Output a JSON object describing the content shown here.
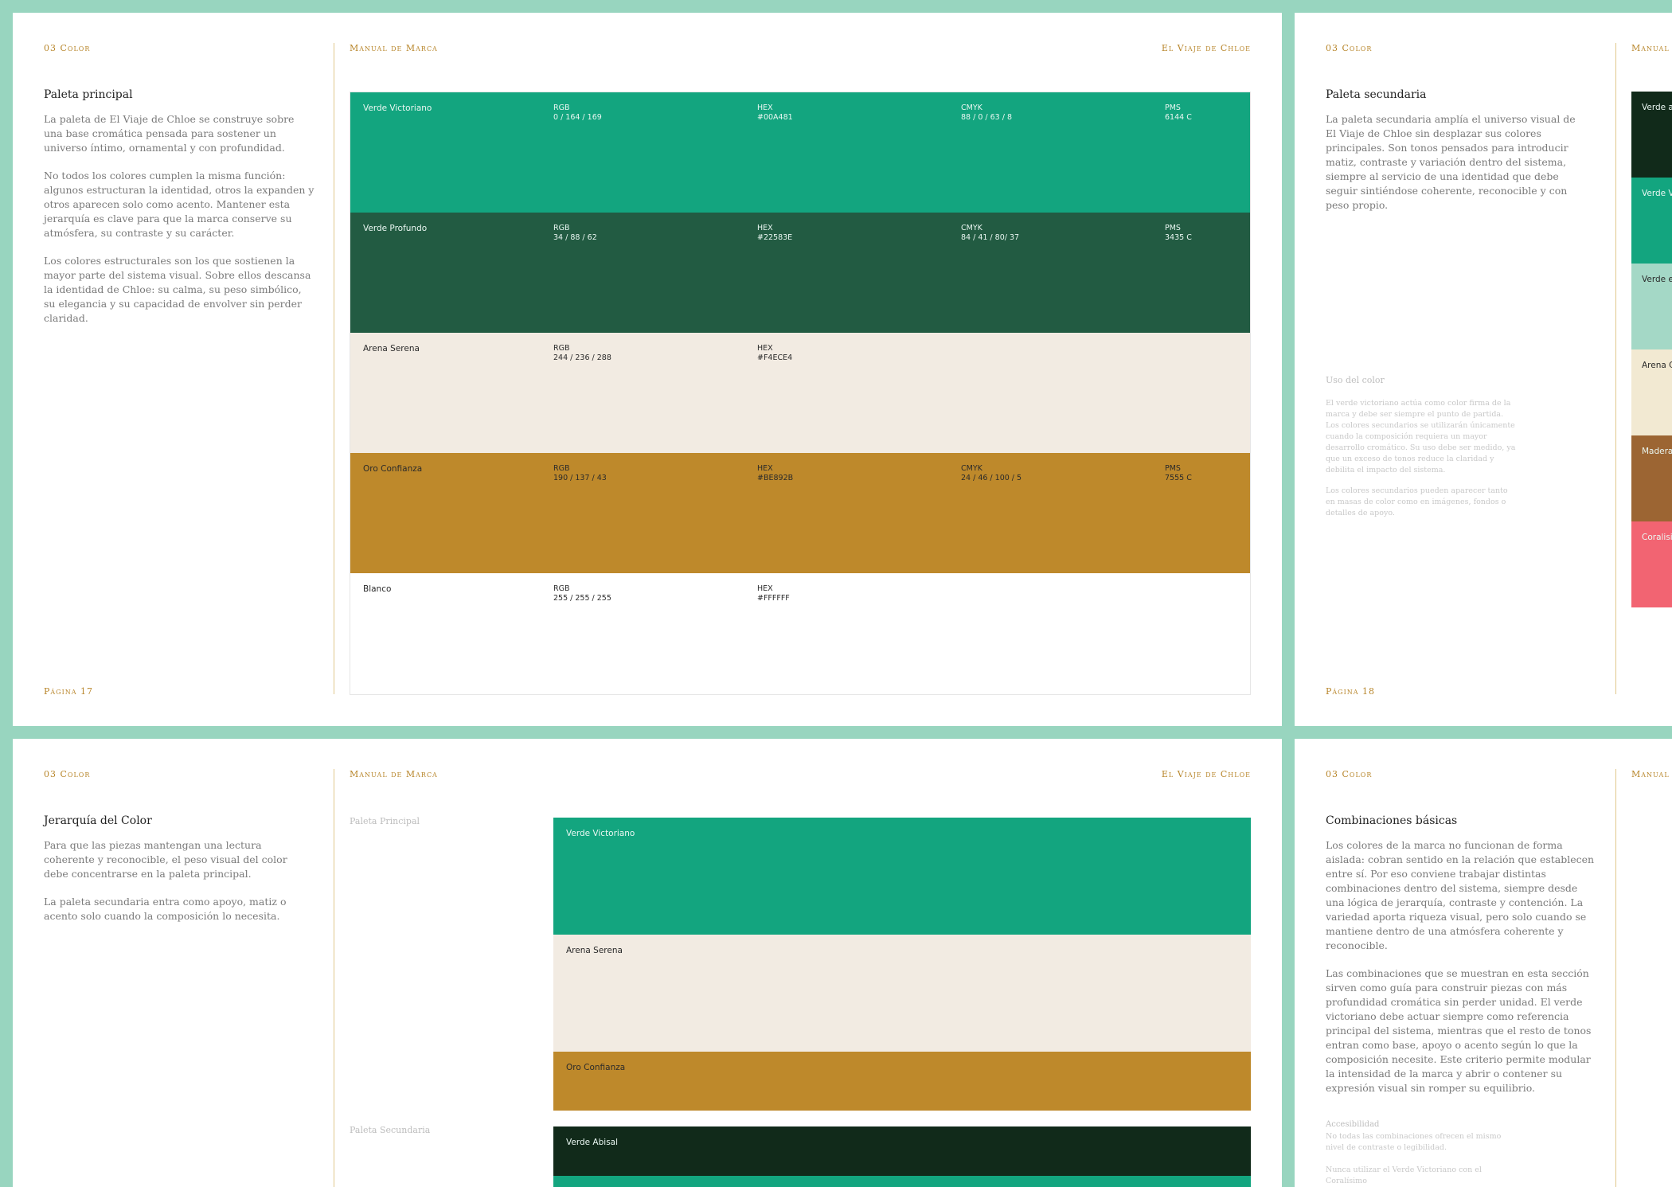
{
  "colors": {
    "verde_victoriano": "#13A57F",
    "verde_profundo": "#225B42",
    "arena_serena": "#F2EBE2",
    "oro_confianza": "#BE892B",
    "blanco": "#FFFFFF",
    "verde_abisal": "#112A1A",
    "verde_medio": "#A4D8C6",
    "arena_claro": "#F2E9D2",
    "madera": "#9C6533",
    "coralisimo": "#F26472",
    "accent": "#B8862B"
  },
  "page17": {
    "section": "03 Color",
    "manual": "Manual de Marca",
    "brand": "El Viaje de Chloe",
    "title": "Paleta principal",
    "paragraphs": [
      "La paleta de El Viaje de Chloe se construye sobre una base cromática pensada para sostener un universo íntimo, ornamental y con profundidad.",
      "No todos los colores cumplen la misma función: algunos estructuran la identidad, otros la expanden y otros aparecen solo como acento. Mantener esta jerarquía es clave para que la marca conserve su atmósfera, su contraste y su carácter.",
      "Los colores estructurales son los que sostienen la mayor parte del sistema visual. Sobre ellos descansa la identidad de Chloe: su calma, su peso simbólico, su elegancia y su capacidad de envolver sin perder claridad."
    ],
    "page_label": "Página 17",
    "swatches": [
      {
        "name": "Verde Victoriano",
        "rgb_label": "RGB",
        "rgb": "0 / 164 / 169",
        "hex_label": "HEX",
        "hex": "#00A481",
        "cmyk_label": "CMYK",
        "cmyk": "88 / 0 / 63 / 8",
        "pms_label": "PMS",
        "pms": "6144 C",
        "color": "#13A57F",
        "text": "light"
      },
      {
        "name": "Verde Profundo",
        "rgb_label": "RGB",
        "rgb": "34 / 88 / 62",
        "hex_label": "HEX",
        "hex": "#22583E",
        "cmyk_label": "CMYK",
        "cmyk": "84 / 41 / 80/ 37",
        "pms_label": "PMS",
        "pms": "3435 C",
        "color": "#225B42",
        "text": "light"
      },
      {
        "name": "Arena Serena",
        "rgb_label": "RGB",
        "rgb": "244 / 236 / 288",
        "hex_label": "HEX",
        "hex": "#F4ECE4",
        "cmyk_label": "",
        "cmyk": "",
        "pms_label": "",
        "pms": "",
        "color": "#F2EBE2",
        "text": "dark"
      },
      {
        "name": "Oro Confianza",
        "rgb_label": "RGB",
        "rgb": "190 / 137 / 43",
        "hex_label": "HEX",
        "hex": "#BE892B",
        "cmyk_label": "CMYK",
        "cmyk": "24 / 46 / 100 / 5",
        "pms_label": "PMS",
        "pms": "7555 C",
        "color": "#BE892B",
        "text": "dark"
      },
      {
        "name": "Blanco",
        "rgb_label": "RGB",
        "rgb": "255 / 255 / 255",
        "hex_label": "HEX",
        "hex": "#FFFFFF",
        "cmyk_label": "",
        "cmyk": "",
        "pms_label": "",
        "pms": "",
        "color": "#FFFFFF",
        "text": "dark"
      }
    ]
  },
  "page18": {
    "section": "03 Color",
    "manual": "Manual d",
    "title": "Paleta secundaria",
    "paragraph": "La paleta secundaria amplía el universo visual de El Viaje de Chloe sin desplazar sus colores principales. Son tonos pensados para introducir matiz, contraste y variación dentro del sistema, siempre al servicio de una identidad que debe seguir sintiéndose coherente, reconocible y con peso propio.",
    "uso_title": "Uso del color",
    "uso_paragraphs": [
      "El verde victoriano actúa como color firma de la marca y debe ser siempre el punto de partida. Los colores secundarios se utilizarán únicamente cuando la composición requiera un mayor desarrollo cromático. Su uso debe ser medido, ya que un exceso de tonos reduce la claridad y debilita el impacto del sistema.",
      "Los colores secundarios pueden aparecer tanto en masas de color como en imágenes, fondos o detalles de apoyo."
    ],
    "page_label": "Página 18",
    "strips": [
      {
        "label": "Verde a",
        "color": "#112A1A",
        "text": "light"
      },
      {
        "label": "Verde V",
        "color": "#13A57F",
        "text": "light"
      },
      {
        "label": "Verde e",
        "color": "#A4D8C6",
        "text": "dark"
      },
      {
        "label": "Arena C",
        "color": "#F2E9D2",
        "text": "dark"
      },
      {
        "label": "Madera",
        "color": "#9C6533",
        "text": "light"
      },
      {
        "label": "Coralisi",
        "color": "#F26472",
        "text": "light"
      }
    ]
  },
  "page19": {
    "section": "03 Color",
    "manual": "Manual de Marca",
    "brand": "El Viaje de Chloe",
    "title": "Jerarquía del Color",
    "paragraphs": [
      "Para que las piezas mantengan una lectura coherente y reconocible, el peso visual del color debe concentrarse en la paleta principal.",
      "La paleta secundaria entra como apoyo, matiz o acento solo cuando la composición lo necesita."
    ],
    "principal_label": "Paleta Principal",
    "secundaria_label": "Paleta Secundaria",
    "principal": [
      {
        "label": "Verde Victoriano",
        "color": "#13A57F",
        "text": "light"
      },
      {
        "label": "Arena Serena",
        "color": "#F2EBE2",
        "text": "dark"
      },
      {
        "label": "Oro Confianza",
        "color": "#BE892B",
        "text": "dark"
      }
    ],
    "secundaria": [
      {
        "label": "Verde Abisal",
        "color": "#112A1A",
        "text": "light"
      }
    ]
  },
  "page20": {
    "section": "03 Color",
    "manual": "Manual d",
    "title": "Combinaciones básicas",
    "paragraphs": [
      "Los colores de la marca no funcionan de forma aislada: cobran sentido en la relación que establecen entre sí. Por eso conviene trabajar distintas combinaciones dentro del sistema, siempre desde una lógica de jerarquía, contraste y contención. La variedad aporta riqueza visual, pero solo cuando se mantiene dentro de una atmósfera coherente y reconocible.",
      "Las combinaciones que se muestran en esta sección sirven como guía para construir piezas con más profundidad cromática sin perder unidad. El verde victoriano debe actuar siempre como referencia principal del sistema, mientras que el resto de tonos entran como base, apoyo o acento según lo que la composición necesite. Este criterio permite modular la intensidad de la marca y abrir o contener su expresión visual sin romper su equilibrio."
    ],
    "accesibilidad_title": "Accesibilidad",
    "accesibilidad_text": "No todas las combinaciones ofrecen el mismo nivel de contraste o legibilidad.",
    "accesibilidad_note": "Nunca utilizar el Verde Victoriano con el Coralísimo"
  }
}
